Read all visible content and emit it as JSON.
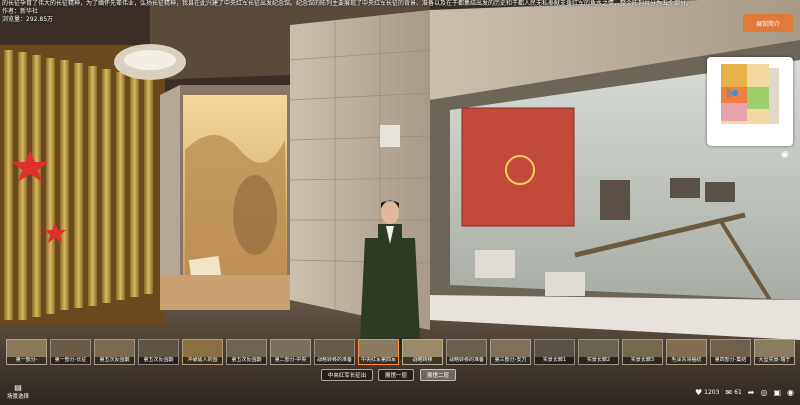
{
  "header": {
    "description": "的长征孕育了伟大的长征精神，为了缅怀先辈伟业，弘扬长征精神，我县在此兴建了中央红军长征出发纪念馆。纪念馆的陈列主要展现了中央红军长征的背景、准备以及在于都集结出发的历史和于都人民无私奉献支援红军的鱼水之情，整个陈列共分为五个部分。",
    "author_label": "作者：",
    "author": "新华社",
    "views_label": "浏览量：",
    "views": "292.85万"
  },
  "intro_button": "展馆简介",
  "thumbnails": [
    {
      "label": "第一部分-"
    },
    {
      "label": "第一部分-长征"
    },
    {
      "label": "第五次反围剿"
    },
    {
      "label": "第五次反围剿"
    },
    {
      "label": "冲破敌人的围"
    },
    {
      "label": "第五次反围剿"
    },
    {
      "label": "第二部分-中央"
    },
    {
      "label": "战略转移的准备"
    },
    {
      "label": "中央红军第四军"
    },
    {
      "label": "战略转移"
    },
    {
      "label": "战略转移的准备"
    },
    {
      "label": "第三部分-支力"
    },
    {
      "label": "实景长廊1"
    },
    {
      "label": "实景长廊2"
    },
    {
      "label": "实景长廊3"
    },
    {
      "label": "毛泽东领袖纺"
    },
    {
      "label": "第四部分-集结"
    },
    {
      "label": "大型实景-瑞于"
    }
  ],
  "tabs": [
    "中央红军长征出",
    "展馆一层",
    "展馆二层"
  ],
  "scene_select_label": "场景选择",
  "stats": {
    "likes": "1203",
    "comments": "61"
  },
  "icons": [
    "heart-icon",
    "comment-icon",
    "share-icon",
    "gyroscope-icon",
    "fullscreen-icon",
    "eye-icon",
    "location-pin-icon",
    "scene-select-icon"
  ],
  "colors": {
    "accent": "#e07a3a",
    "active_thumb": "#ff8c3a"
  }
}
